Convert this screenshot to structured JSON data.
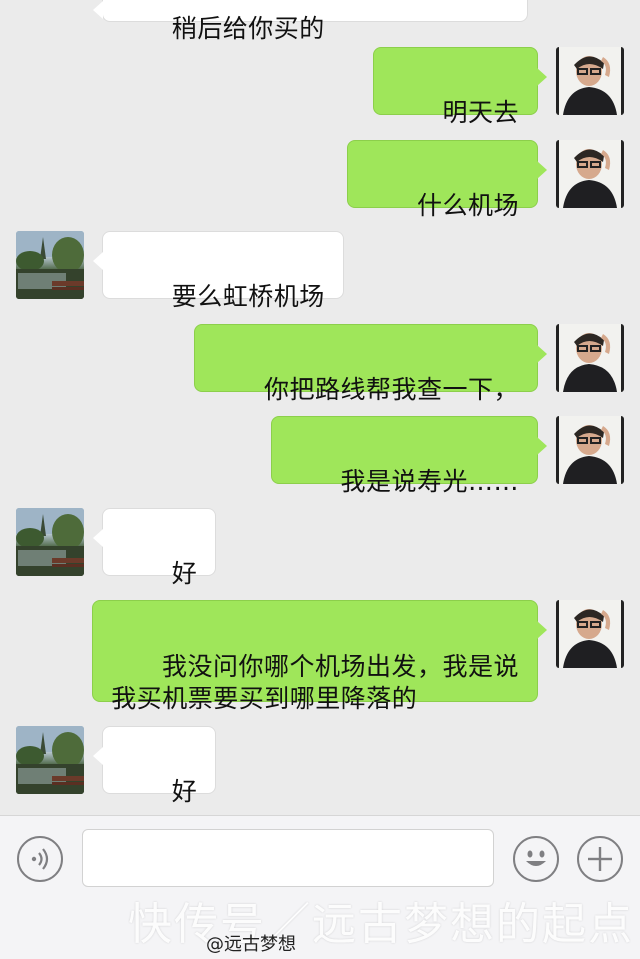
{
  "messages": [
    {
      "side": "them",
      "text": "稍后给你买的",
      "partial": true
    },
    {
      "side": "me",
      "text": "明天去"
    },
    {
      "side": "me",
      "text": "什么机场"
    },
    {
      "side": "them",
      "text": "要么虹桥机场"
    },
    {
      "side": "me",
      "text": "你把路线帮我查一下，"
    },
    {
      "side": "me",
      "text": "我是说寿光……"
    },
    {
      "side": "them",
      "text": "好"
    },
    {
      "side": "me",
      "text": "我没问你哪个机场出发，我是说\n我买机票要买到哪里降落的"
    },
    {
      "side": "them",
      "text": "好"
    }
  ],
  "input": {
    "placeholder": ""
  },
  "icons": {
    "voice": "voice-icon",
    "emoji": "emoji-icon",
    "plus": "plus-icon"
  },
  "watermark": {
    "main": "快传号／远古梦想的起点",
    "small": "@远古梦想"
  },
  "colors": {
    "me_bubble": "#9fe65a",
    "them_bubble": "#ffffff",
    "background": "#ebebeb"
  }
}
